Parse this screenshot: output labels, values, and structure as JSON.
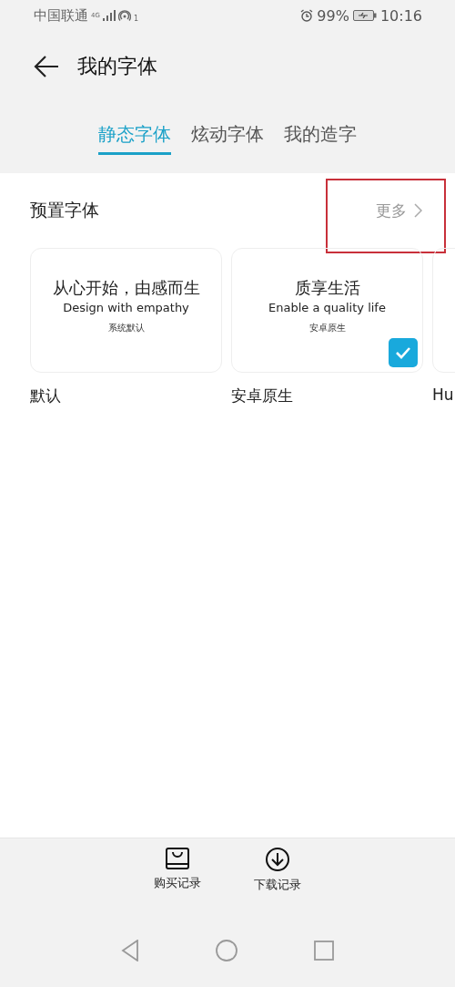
{
  "status_bar": {
    "carrier": "中国联通",
    "network": "4G",
    "hotspot_count": "1",
    "battery": "99%",
    "time": "10:16"
  },
  "header": {
    "title": "我的字体"
  },
  "tabs": [
    {
      "label": "静态字体",
      "selected": true
    },
    {
      "label": "炫动字体",
      "selected": false
    },
    {
      "label": "我的造字",
      "selected": false
    }
  ],
  "section": {
    "title": "预置字体",
    "more": "更多"
  },
  "fonts": [
    {
      "name": "默认",
      "preview_title": "从心开始，由感而生",
      "preview_subtitle": "Design with empathy",
      "preview_caption": "系统默认",
      "selected": false
    },
    {
      "name": "安卓原生",
      "preview_title": "质享生活",
      "preview_subtitle": "Enable a quality life",
      "preview_caption": "安卓原生",
      "selected": true
    },
    {
      "name": "Hu"
    }
  ],
  "bottom_actions": [
    {
      "kind": "bag",
      "label": "购买记录"
    },
    {
      "kind": "download",
      "label": "下载记录"
    }
  ]
}
